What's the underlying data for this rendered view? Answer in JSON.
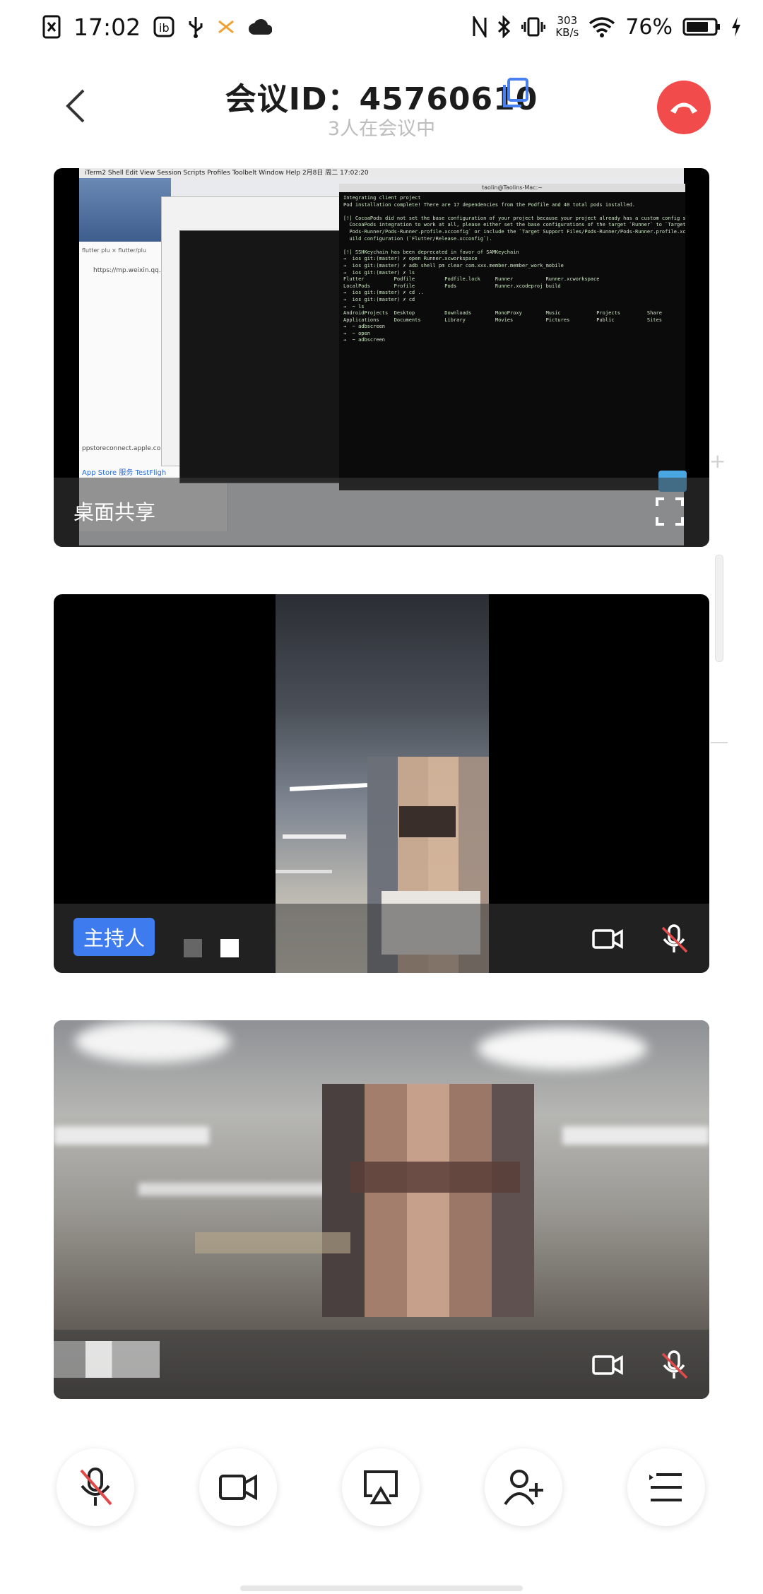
{
  "status_bar": {
    "time": "17:02",
    "net_speed_value": "303",
    "net_speed_unit": "KB/s",
    "battery": "76%"
  },
  "header": {
    "meeting_title": "会议ID：45760610",
    "participants_status": "3人在会议中"
  },
  "tiles": [
    {
      "label": "桌面共享",
      "screen": {
        "menubar": " iTerm2  Shell  Edit  View  Session  Scripts  Profiles  Toolbelt  Window  Help                                   2月8日 周二 17:02:20",
        "terminal_title": "taolin@Taolins-Mac:~",
        "browser_url": "https://mp.weixin.qq.com",
        "browser_tabs": "flutter plu  ×   flutter/plu",
        "asc_url": "ppstoreconnect.apple.com/ap",
        "asc_tabs": "App Store   服务    TestFligh",
        "terminal_text": "Integrating client project\nPod installation complete! There are 17 dependencies from the Podfile and 40 total pods installed.\n\n[!] CocoaPods did not set the base configuration of your project because your project already has a custom config set.\n  CocoaPods integration to work at all, please either set the base configurations of the target `Runner` to `Target Support\n  Pods-Runner/Pods-Runner.profile.xcconfig` or include the `Target Support Files/Pods-Runner/Pods-Runner.profile.xcconfig`\n  uild configuration (`Flutter/Release.xcconfig`).\n\n[!] SSHKeychain has been deprecated in favor of SAMKeychain\n→  ios git:(master) ✗ open Runner.xcworkspace\n→  ios git:(master) ✗ adb shell pm clear com.xxx.member.member_work_mobile\n→  ios git:(master) ✗ ls\nFlutter          Podfile          Podfile.lock     Runner           Runner.xcworkspace\nLocalPods        Profile          Pods             Runner.xcodeproj build\n→  ios git:(master) ✗ cd ..\n→  ios git:(master) ✗ cd\n→  ~ ls\nAndroidProjects  Desktop          Downloads        MonoProxy        Music            Projects         Share\nApplications     Documents        Library          Movies           Pictures         Public           Sites\n→  ~ adbscreen\n→  ~ open\n→  ~ adbscreen"
      }
    },
    {
      "host_badge": "主持人"
    },
    {}
  ],
  "colors": {
    "hangup": "#f24b4b",
    "accent": "#3e7bef",
    "muted_red": "#e24a4a"
  },
  "toolbar": {
    "buttons": [
      "mic-muted",
      "camera",
      "screen-share",
      "add-participant",
      "more-menu"
    ]
  }
}
